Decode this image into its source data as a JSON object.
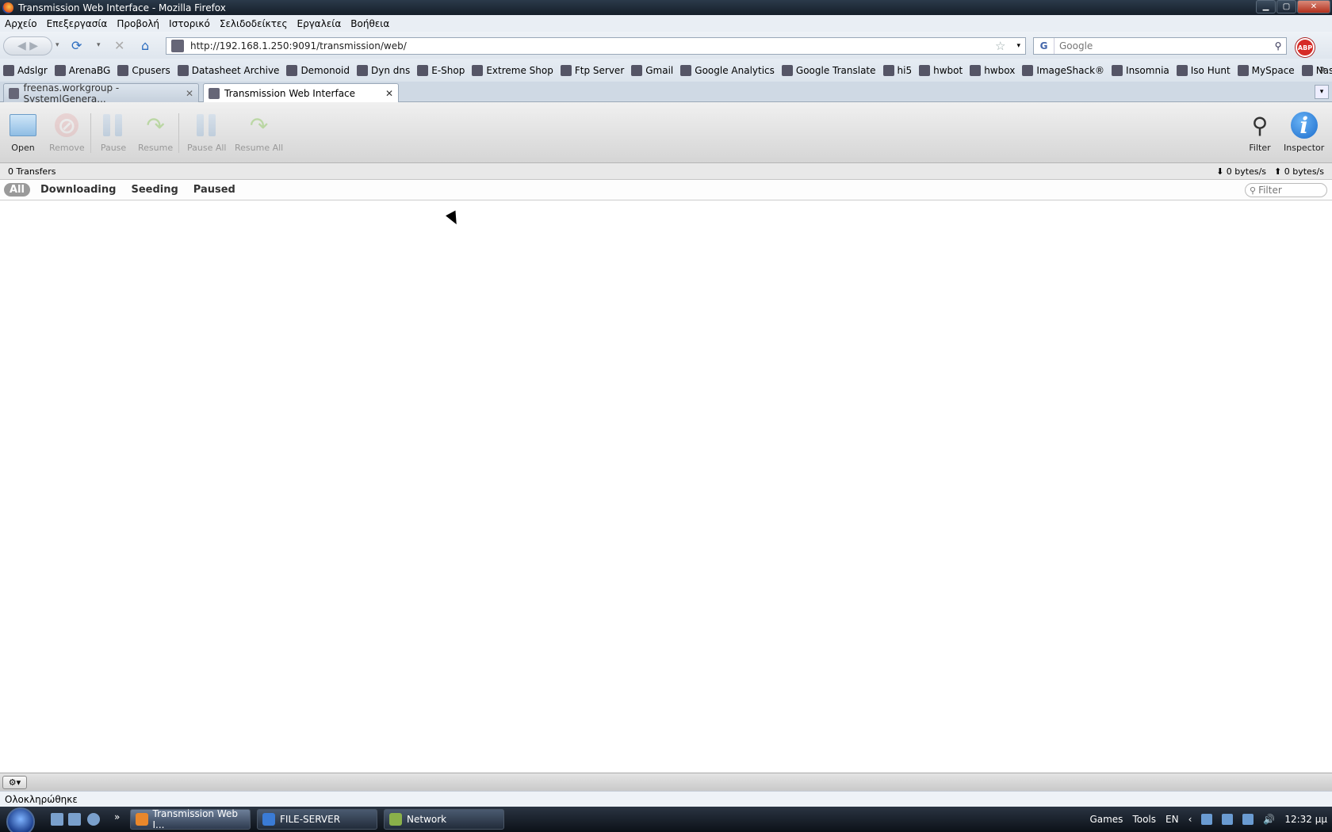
{
  "window": {
    "title": "Transmission Web Interface - Mozilla Firefox"
  },
  "menu": [
    "Αρχείο",
    "Επεξεργασία",
    "Προβολή",
    "Ιστορικό",
    "Σελιδοδείκτες",
    "Εργαλεία",
    "Βοήθεια"
  ],
  "nav": {
    "url": "http://192.168.1.250:9091/transmission/web/",
    "search_placeholder": "Google",
    "search_engine_letter": "G",
    "abp_label": "ABP"
  },
  "bookmarks": [
    "Adslgr",
    "ArenaBG",
    "Cpusers",
    "Datasheet Archive",
    "Demonoid",
    "Dyn dns",
    "E-Shop",
    "Extreme Shop",
    "Ftp Server",
    "Gmail",
    "Google Analytics",
    "Google Translate",
    "hi5",
    "hwbot",
    "hwbox",
    "ImageShack®",
    "Insomnia",
    "Iso Hunt",
    "MySpace",
    "Nas Server"
  ],
  "tabs": [
    {
      "label": "freenas.workgroup - System|Genera...",
      "active": false
    },
    {
      "label": "Transmission Web Interface",
      "active": true
    }
  ],
  "toolbar": {
    "open": "Open",
    "remove": "Remove",
    "pause": "Pause",
    "resume": "Resume",
    "pause_all": "Pause All",
    "resume_all": "Resume All",
    "filter": "Filter",
    "inspector": "Inspector"
  },
  "status": {
    "transfers": "0 Transfers",
    "download_speed": "0 bytes/s",
    "upload_speed": "0 bytes/s"
  },
  "filters": {
    "all": "All",
    "downloading": "Downloading",
    "seeding": "Seeding",
    "paused": "Paused",
    "search_placeholder": "Filter"
  },
  "ff_status": "Ολοκληρώθηκε",
  "taskbar": {
    "buttons": [
      "Transmission Web I...",
      "FILE-SERVER",
      "Network"
    ],
    "tray_games": "Games",
    "tray_tools": "Tools",
    "lang": "EN",
    "clock": "12:32 μμ"
  }
}
